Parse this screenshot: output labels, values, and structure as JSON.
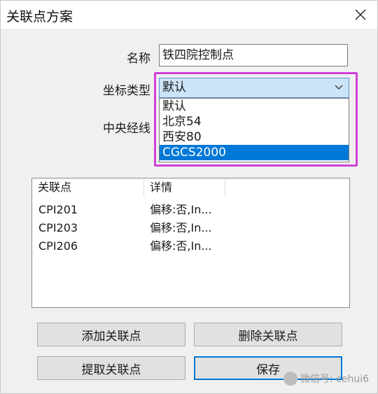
{
  "window": {
    "title": "关联点方案"
  },
  "form": {
    "name_label": "名称",
    "name_value": "铁四院控制点",
    "coord_type_label": "坐标类型",
    "coord_type_selected": "默认",
    "central_meridian_label": "中央经线"
  },
  "dropdown": {
    "options": [
      "默认",
      "北京54",
      "西安80",
      "CGCS2000"
    ],
    "highlighted_index": 3
  },
  "listview": {
    "columns": [
      "关联点",
      "详情"
    ],
    "rows": [
      {
        "point": "CPI201",
        "detail": "偏移:否,In..."
      },
      {
        "point": "CPI203",
        "detail": "偏移:否,In..."
      },
      {
        "point": "CPI206",
        "detail": "偏移:否,In..."
      }
    ]
  },
  "buttons": {
    "add": "添加关联点",
    "delete": "删除关联点",
    "extract": "提取关联点",
    "save": "保存"
  },
  "watermark": {
    "text": "微信号: cehui6"
  },
  "colors": {
    "highlight_border": "#d040d8",
    "selection": "#0078d7",
    "combo_bg": "#cce4f7"
  }
}
